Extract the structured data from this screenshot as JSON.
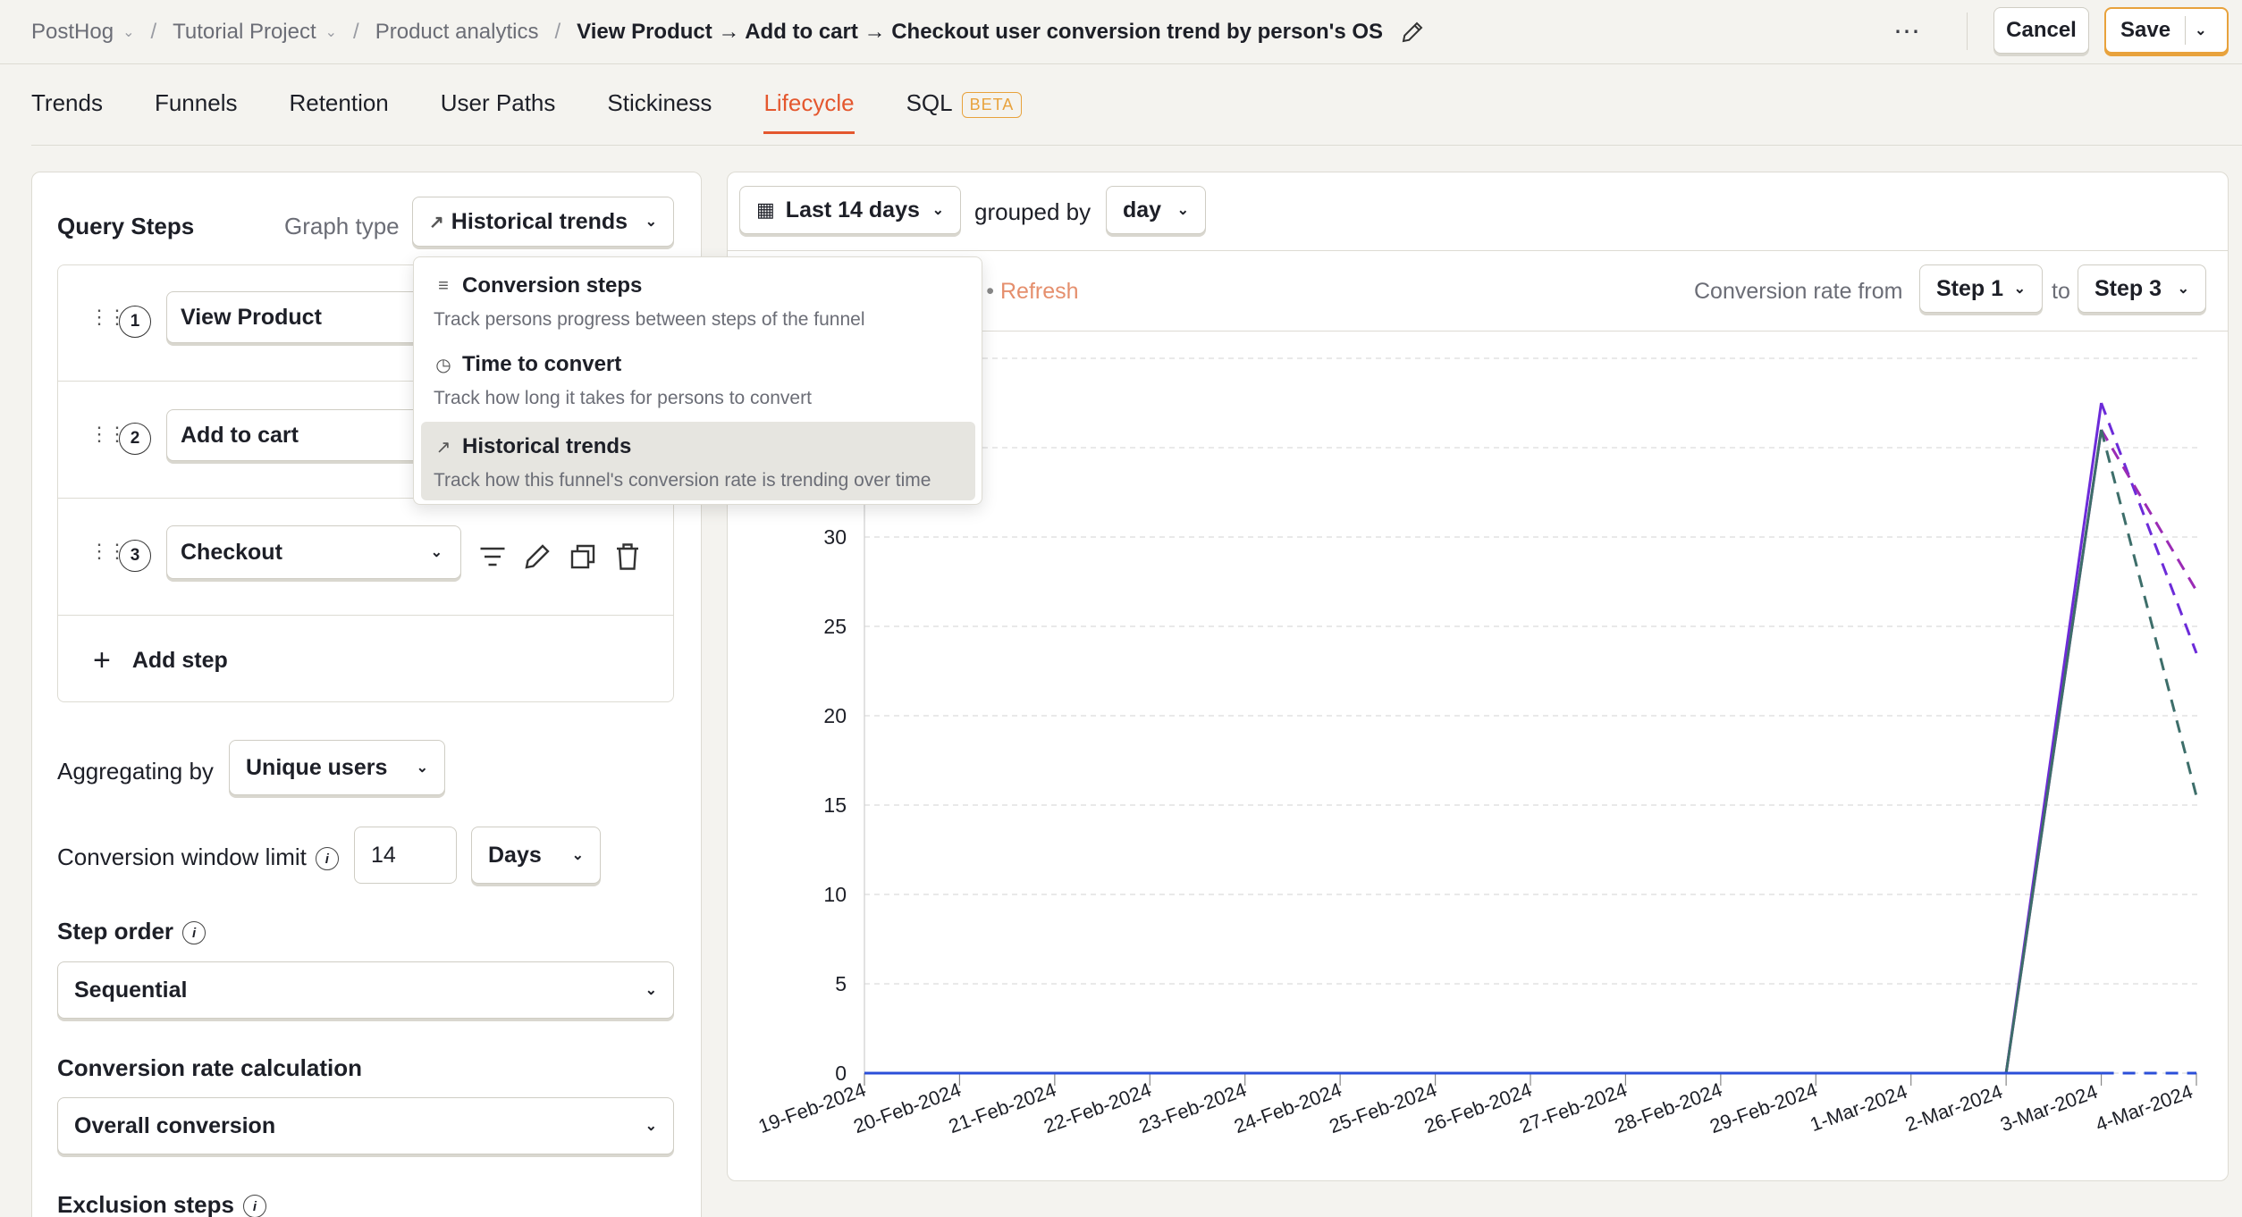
{
  "breadcrumbs": {
    "org": "PostHog",
    "project": "Tutorial Project",
    "section": "Product analytics",
    "title": "View Product → Add to cart → Checkout user conversion trend by person's OS"
  },
  "header_actions": {
    "cancel": "Cancel",
    "save": "Save"
  },
  "tabs": [
    {
      "label": "Trends"
    },
    {
      "label": "Funnels"
    },
    {
      "label": "Retention"
    },
    {
      "label": "User Paths"
    },
    {
      "label": "Stickiness"
    },
    {
      "label": "Lifecycle",
      "active": true
    },
    {
      "label": "SQL",
      "badge": "BETA"
    }
  ],
  "query": {
    "title": "Query Steps",
    "graph_type_label": "Graph type",
    "graph_type_value": "Historical trends",
    "steps": [
      {
        "num": "1",
        "event": "View Product"
      },
      {
        "num": "2",
        "event": "Add to cart"
      },
      {
        "num": "3",
        "event": "Checkout"
      }
    ],
    "add_step": "Add step",
    "aggregating_label": "Aggregating by",
    "aggregating_value": "Unique users",
    "conv_window_label": "Conversion window limit",
    "conv_window_value": "14",
    "conv_window_unit": "Days",
    "step_order_label": "Step order",
    "step_order_value": "Sequential",
    "conv_calc_label": "Conversion rate calculation",
    "conv_calc_value": "Overall conversion",
    "exclusion_label": "Exclusion steps"
  },
  "graph_type_menu": [
    {
      "title": "Conversion steps",
      "desc": "Track persons progress between steps of the funnel",
      "icon": "funnel-icon"
    },
    {
      "title": "Time to convert",
      "desc": "Track how long it takes for persons to convert",
      "icon": "clock-icon"
    },
    {
      "title": "Historical trends",
      "desc": "Track how this funnel's conversion rate is trending over time",
      "icon": "trend-icon",
      "selected": true
    }
  ],
  "filters": {
    "date_range": "Last 14 days",
    "grouped_by_label": "grouped by",
    "interval": "day",
    "refresh_prefix": "›",
    "refresh": "Refresh",
    "conv_from_label": "Conversion rate from",
    "from_step": "Step 1",
    "to_label": "to",
    "to_step": "Step 3"
  },
  "chart_data": {
    "type": "line",
    "x": [
      "19-Feb-2024",
      "20-Feb-2024",
      "21-Feb-2024",
      "22-Feb-2024",
      "23-Feb-2024",
      "24-Feb-2024",
      "25-Feb-2024",
      "26-Feb-2024",
      "27-Feb-2024",
      "28-Feb-2024",
      "29-Feb-2024",
      "1-Mar-2024",
      "2-Mar-2024",
      "3-Mar-2024",
      "4-Mar-2024"
    ],
    "y_ticks": [
      0,
      5,
      10,
      15,
      20,
      25,
      30
    ],
    "ylim": [
      0,
      40
    ],
    "series": [
      {
        "color": "#6c2bd9",
        "values": [
          0,
          0,
          0,
          0,
          0,
          0,
          0,
          0,
          0,
          0,
          0,
          0,
          0,
          37.5,
          23.5
        ]
      },
      {
        "color": "#9b2bb5",
        "values": [
          0,
          0,
          0,
          0,
          0,
          0,
          0,
          0,
          0,
          0,
          0,
          0,
          0,
          36,
          27
        ]
      },
      {
        "color": "#3d6e6a",
        "values": [
          0,
          0,
          0,
          0,
          0,
          0,
          0,
          0,
          0,
          0,
          0,
          0,
          0,
          36,
          15.5
        ]
      },
      {
        "color": "#2b4fd9",
        "values": [
          0,
          0,
          0,
          0,
          0,
          0,
          0,
          0,
          0,
          0,
          0,
          0,
          0,
          0,
          0
        ]
      }
    ],
    "dashed_from_index": 13,
    "grid": true
  }
}
